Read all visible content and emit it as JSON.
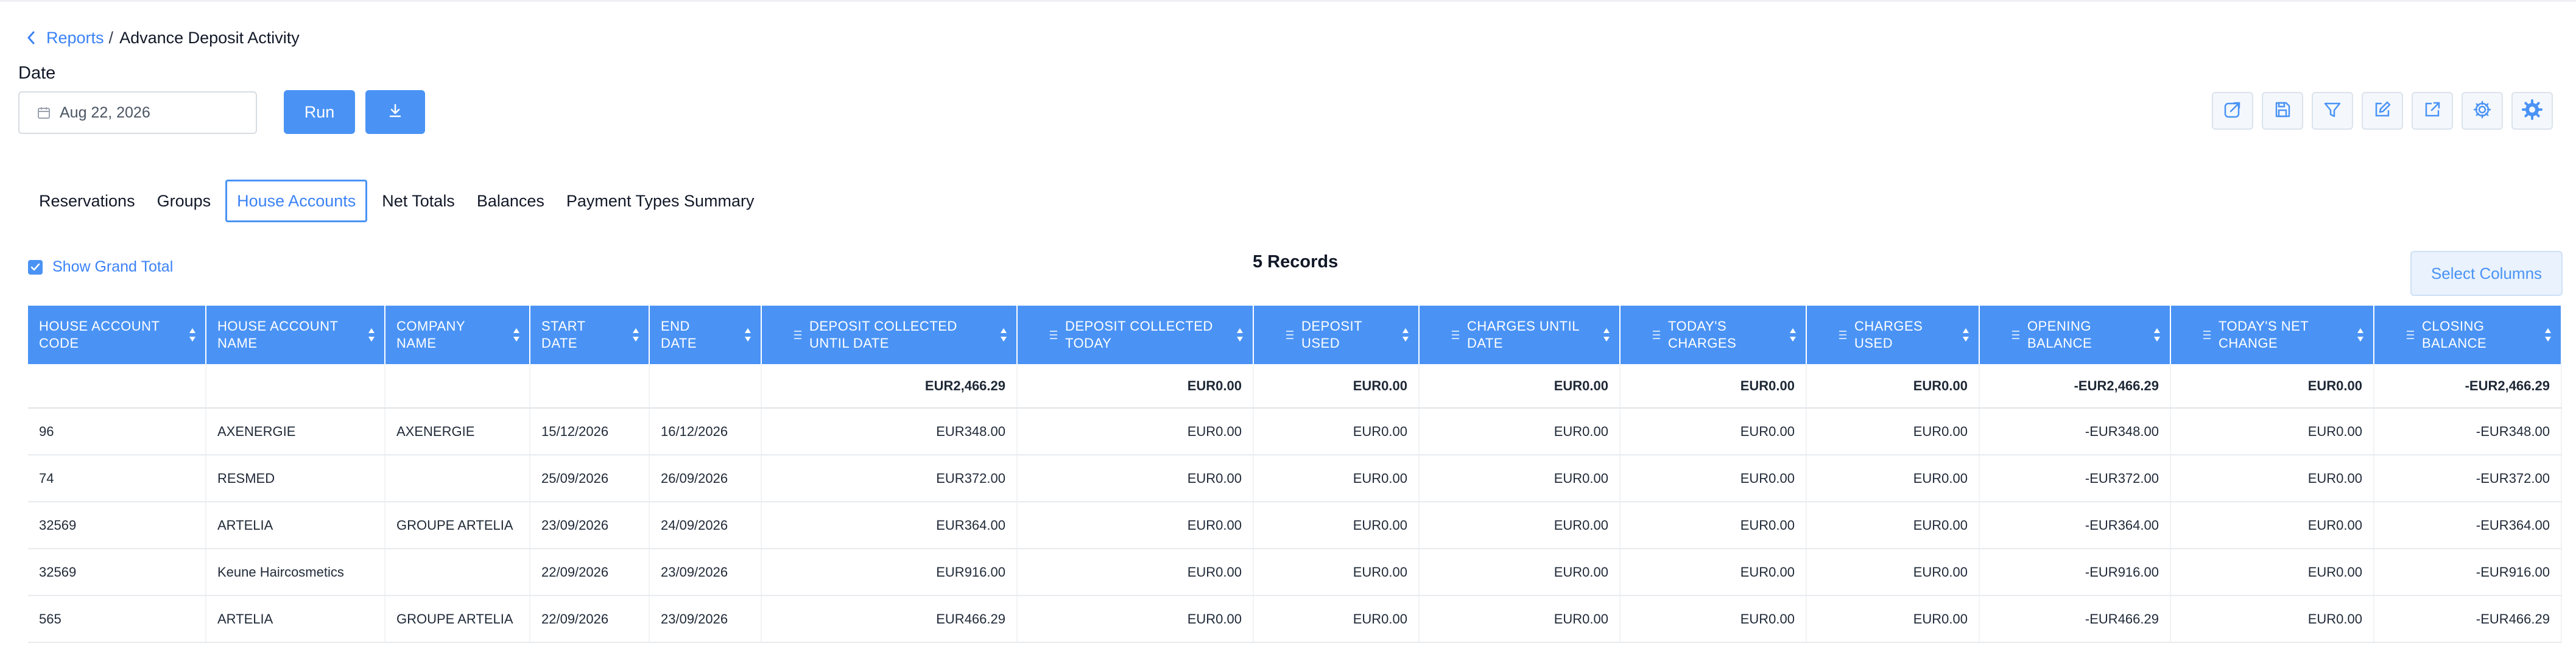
{
  "breadcrumb": {
    "parent": "Reports",
    "separator": "/",
    "current": "Advance Deposit Activity"
  },
  "filters": {
    "date_label": "Date",
    "date_value": "Aug 22, 2026"
  },
  "actions": {
    "run_label": "Run"
  },
  "toolbar_icons": [
    "share-edit-icon",
    "save-icon",
    "filter-icon",
    "edit-icon",
    "external-link-icon",
    "gear-icon",
    "advanced-settings-icon"
  ],
  "tabs": [
    {
      "label": "Reservations",
      "active": false
    },
    {
      "label": "Groups",
      "active": false
    },
    {
      "label": "House Accounts",
      "active": true
    },
    {
      "label": "Net Totals",
      "active": false
    },
    {
      "label": "Balances",
      "active": false
    },
    {
      "label": "Payment Types Summary",
      "active": false
    }
  ],
  "grand_total": {
    "label": "Show Grand Total",
    "checked": true
  },
  "records_label": "5 Records",
  "select_columns_label": "Select Columns",
  "table": {
    "columns": [
      {
        "l1": "HOUSE ACCOUNT",
        "l2": "CODE",
        "numeric": false
      },
      {
        "l1": "HOUSE ACCOUNT",
        "l2": "NAME",
        "numeric": false
      },
      {
        "l1": "COMPANY",
        "l2": "NAME",
        "numeric": false
      },
      {
        "l1": "START",
        "l2": "DATE",
        "numeric": false
      },
      {
        "l1": "END",
        "l2": "DATE",
        "numeric": false
      },
      {
        "l1": "DEPOSIT COLLECTED",
        "l2": "UNTIL DATE",
        "numeric": true
      },
      {
        "l1": "DEPOSIT COLLECTED",
        "l2": "TODAY",
        "numeric": true
      },
      {
        "l1": "DEPOSIT",
        "l2": "USED",
        "numeric": true
      },
      {
        "l1": "CHARGES UNTIL",
        "l2": "DATE",
        "numeric": true
      },
      {
        "l1": "TODAY'S",
        "l2": "CHARGES",
        "numeric": true
      },
      {
        "l1": "CHARGES",
        "l2": "USED",
        "numeric": true
      },
      {
        "l1": "OPENING",
        "l2": "BALANCE",
        "numeric": true
      },
      {
        "l1": "TODAY'S NET",
        "l2": "CHANGE",
        "numeric": true
      },
      {
        "l1": "CLOSING",
        "l2": "BALANCE",
        "numeric": true
      }
    ],
    "totals": [
      "",
      "",
      "",
      "",
      "",
      "EUR2,466.29",
      "EUR0.00",
      "EUR0.00",
      "EUR0.00",
      "EUR0.00",
      "EUR0.00",
      "-EUR2,466.29",
      "EUR0.00",
      "-EUR2,466.29"
    ],
    "rows": [
      [
        "96",
        "AXENERGIE",
        "AXENERGIE",
        "15/12/2026",
        "16/12/2026",
        "EUR348.00",
        "EUR0.00",
        "EUR0.00",
        "EUR0.00",
        "EUR0.00",
        "EUR0.00",
        "-EUR348.00",
        "EUR0.00",
        "-EUR348.00"
      ],
      [
        "74",
        "RESMED",
        "",
        "25/09/2026",
        "26/09/2026",
        "EUR372.00",
        "EUR0.00",
        "EUR0.00",
        "EUR0.00",
        "EUR0.00",
        "EUR0.00",
        "-EUR372.00",
        "EUR0.00",
        "-EUR372.00"
      ],
      [
        "32569",
        "ARTELIA",
        "GROUPE ARTELIA",
        "23/09/2026",
        "24/09/2026",
        "EUR364.00",
        "EUR0.00",
        "EUR0.00",
        "EUR0.00",
        "EUR0.00",
        "EUR0.00",
        "-EUR364.00",
        "EUR0.00",
        "-EUR364.00"
      ],
      [
        "32569",
        "Keune Haircosmetics",
        "",
        "22/09/2026",
        "23/09/2026",
        "EUR916.00",
        "EUR0.00",
        "EUR0.00",
        "EUR0.00",
        "EUR0.00",
        "EUR0.00",
        "-EUR916.00",
        "EUR0.00",
        "-EUR916.00"
      ],
      [
        "565",
        "ARTELIA",
        "GROUPE ARTELIA",
        "22/09/2026",
        "23/09/2026",
        "EUR466.29",
        "EUR0.00",
        "EUR0.00",
        "EUR0.00",
        "EUR0.00",
        "EUR0.00",
        "-EUR466.29",
        "EUR0.00",
        "-EUR466.29"
      ]
    ]
  },
  "colors": {
    "accent": "#4a93f5",
    "link": "#3b82f6",
    "header_text": "#ffffff"
  }
}
